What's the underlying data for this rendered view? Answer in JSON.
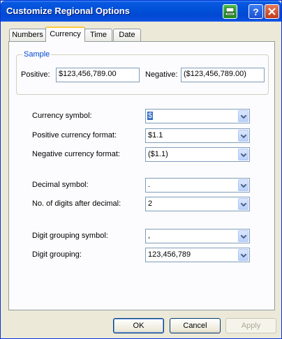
{
  "window": {
    "title": "Customize Regional Options"
  },
  "tabs": [
    {
      "label": "Numbers"
    },
    {
      "label": "Currency"
    },
    {
      "label": "Time"
    },
    {
      "label": "Date"
    }
  ],
  "sample": {
    "group_title": "Sample",
    "positive_label": "Positive:",
    "positive_value": "$123,456,789.00",
    "negative_label": "Negative:",
    "negative_value": "($123,456,789.00)"
  },
  "fields": {
    "currency_symbol": {
      "label": "Currency symbol:",
      "value": "$"
    },
    "positive_format": {
      "label": "Positive currency format:",
      "value": "$1.1"
    },
    "negative_format": {
      "label": "Negative currency format:",
      "value": "($1.1)"
    },
    "decimal_symbol": {
      "label": "Decimal symbol:",
      "value": "."
    },
    "digits_after_decimal": {
      "label": "No. of digits after decimal:",
      "value": "2"
    },
    "digit_grouping_symbol": {
      "label": "Digit grouping symbol:",
      "value": ","
    },
    "digit_grouping": {
      "label": "Digit grouping:",
      "value": "123,456,789"
    }
  },
  "buttons": {
    "ok": "OK",
    "cancel": "Cancel",
    "apply": "Apply"
  },
  "icons": {
    "app": "network-app-icon",
    "help": "help-icon",
    "close": "close-icon",
    "dropdown": "chevron-down-icon"
  },
  "colors": {
    "titlebar": "#0050d8",
    "dialog_bg": "#ece9d8",
    "selection": "#316ac5",
    "group_title": "#0046d5"
  }
}
